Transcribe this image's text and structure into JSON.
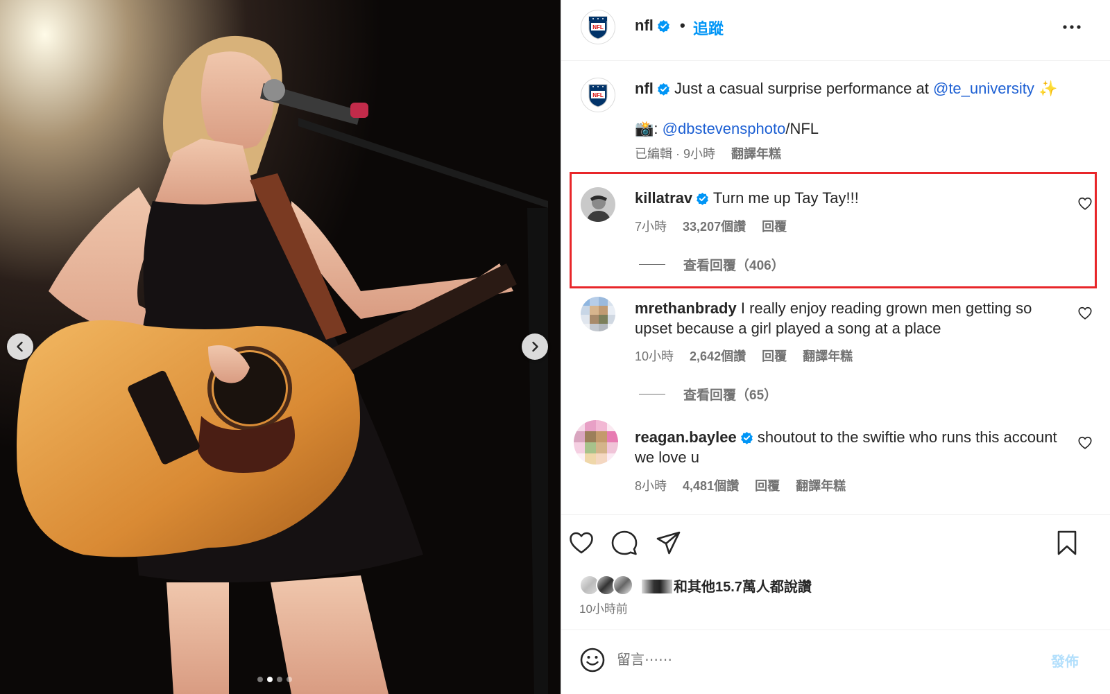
{
  "photo": {
    "alt": "Performer singing into a microphone while playing an acoustic guitar on stage",
    "carousel_dots": 4,
    "active_dot": 1
  },
  "header": {
    "username": "nfl",
    "separator": "•",
    "follow_label": "追蹤"
  },
  "caption": {
    "username": "nfl",
    "text_before": "Just a casual surprise performance at",
    "mention": "@te_university",
    "sparkle": "✨",
    "credit_emoji": "📸",
    "credit_colon": ":",
    "credit_mention": "@dbstevensphoto",
    "credit_suffix": "/NFL",
    "edited": "已編輯 · 9小時",
    "translate": "翻譯年糕"
  },
  "comments": [
    {
      "username": "killatrav",
      "verified": true,
      "text": "Turn me up Tay Tay!!!",
      "time": "7小時",
      "likes": "33,207個讚",
      "reply": "回覆",
      "view_replies": "查看回覆（406）",
      "highlighted": true
    },
    {
      "username": "mrethanbrady",
      "verified": false,
      "text": "I really enjoy reading grown men getting so upset because a girl played a song at a place",
      "time": "10小時",
      "likes": "2,642個讚",
      "reply": "回覆",
      "translate": "翻譯年糕",
      "view_replies": "查看回覆（65）"
    },
    {
      "username": "reagan.baylee",
      "verified": true,
      "text": "shoutout to the swiftie who runs this account we love u",
      "time": "8小時",
      "likes": "4,481個讚",
      "reply": "回覆",
      "translate": "翻譯年糕"
    }
  ],
  "actions": {
    "likes_text": "和其他15.7萬人都說讚",
    "post_time": "10小時前"
  },
  "comment_box": {
    "placeholder": "留言⋯⋯",
    "post_label": "發佈"
  },
  "colors": {
    "link_blue": "#0095f6",
    "mention": "#00376b",
    "muted": "#737373",
    "highlight": "#e8262a",
    "verified": "#0095f6"
  }
}
